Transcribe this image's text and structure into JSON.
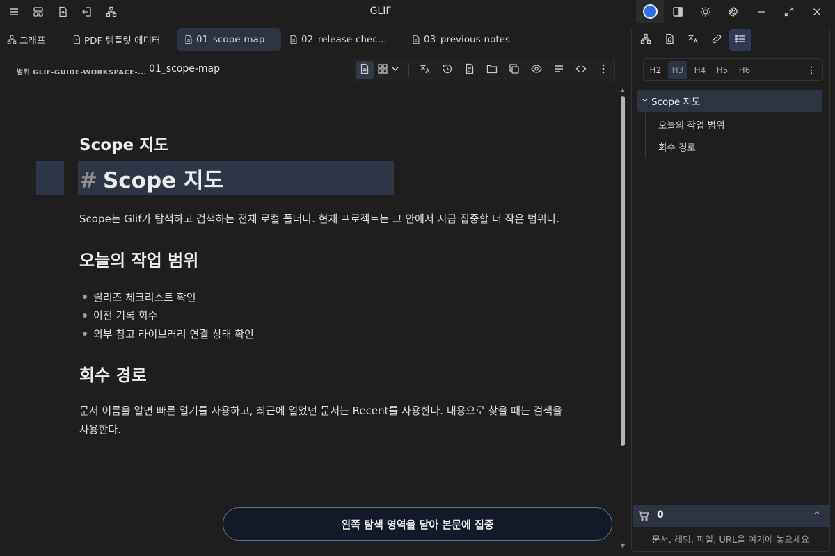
{
  "window": {
    "title": "GLIF",
    "left_tools": [
      "menu-icon",
      "layout-icon",
      "upload-icon",
      "logout-icon",
      "network-icon"
    ],
    "right_tools": [
      "record-icon",
      "sidebar-toggle-icon",
      "brightness-icon",
      "gear-icon",
      "minimize-icon",
      "maximize-icon",
      "close-icon"
    ]
  },
  "tabs": [
    {
      "label": "그래프",
      "icon": "graph-icon",
      "active": false
    },
    {
      "label": "PDF 템플릿 에디터",
      "icon": "file-upload-icon",
      "active": false
    },
    {
      "label": "01_scope-map",
      "icon": "document-icon",
      "active": true
    },
    {
      "label": "02_release-chec...",
      "icon": "document-icon",
      "active": false
    },
    {
      "label": "03_previous-notes",
      "icon": "document-icon",
      "active": false
    }
  ],
  "breadcrumb": {
    "scope": "범위 GLIF-GUIDE-WORKSPACE-...",
    "document": "01_scope-map"
  },
  "toolbar": {
    "buttons": [
      "document-icon",
      "grid-icon",
      "chevron-down-icon",
      "translate-icon",
      "history-icon",
      "file-icon",
      "folder-icon",
      "copy-icon",
      "eye-icon",
      "align-icon",
      "code-icon",
      "more-icon"
    ]
  },
  "editor": {
    "rendered_title": "Scope 지도",
    "heading_marker": "#",
    "heading_text": "Scope 지도",
    "paragraph1": "Scope는 Glif가 탐색하고 검색하는 전체 로컬 폴더다. 현재 프로젝트는 그 안에서 지금 집중할 더 작은 범위다.",
    "section1_title": "오늘의 작업 범위",
    "bullets": [
      "릴리즈 체크리스트 확인",
      "이전 기록 회수",
      "외부 참고 라이브러리 연결 상태 확인"
    ],
    "section2_title": "회수 경로",
    "paragraph2": "문서 이름을 알면 빠른 열기를 사용하고, 최근에 열었던 문서는 Recent를 사용한다. 내용으로 찾을 때는 검색을 사용한다."
  },
  "focus_button": {
    "label": "왼쪽 탐색 영역을 닫아 본문에 집중"
  },
  "panel": {
    "tabs": [
      "graph-icon",
      "file-link-icon",
      "translate-icon",
      "link-icon",
      "list-icon"
    ],
    "heading_levels": [
      "H2",
      "H3",
      "H4",
      "H5",
      "H6"
    ],
    "outline": {
      "root": "Scope 지도",
      "children": [
        "오늘의 작업 범위",
        "회수 경로"
      ]
    },
    "cart": {
      "count": "0"
    },
    "dropzone": "문서, 헤딩, 파일, URL을 여기에 놓으세요"
  },
  "colors": {
    "background": "#1e1e1e",
    "active_highlight": "#2c3444",
    "accent": "#2f6fe4",
    "focus_border": "#5b6f93"
  }
}
